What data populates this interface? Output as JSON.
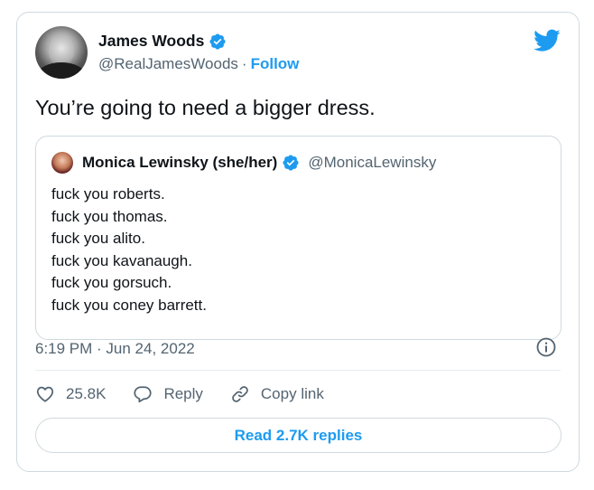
{
  "author": {
    "name": "James Woods",
    "handle": "@RealJamesWoods",
    "separator": "·",
    "follow_label": "Follow"
  },
  "tweet": {
    "text": "You’re going to need a bigger dress."
  },
  "quoted": {
    "name": "Monica Lewinsky (she/her)",
    "handle": "@MonicaLewinsky",
    "lines": [
      "fuck you roberts.",
      "fuck you thomas.",
      "fuck you alito.",
      "fuck you kavanaugh.",
      "fuck you gorsuch.",
      "fuck you coney barrett."
    ]
  },
  "meta": {
    "timestamp": "6:19 PM · Jun 24, 2022"
  },
  "actions": {
    "like_count": "25.8K",
    "reply_label": "Reply",
    "copy_link_label": "Copy link"
  },
  "footer": {
    "read_replies_label": "Read 2.7K replies"
  },
  "colors": {
    "accent": "#1d9bf0",
    "text": "#0f1419",
    "secondary": "#536471",
    "border": "#cfd9de"
  },
  "icons": [
    "verified-badge-icon",
    "twitter-bird-icon",
    "info-icon",
    "heart-icon",
    "reply-bubble-icon",
    "link-icon"
  ]
}
